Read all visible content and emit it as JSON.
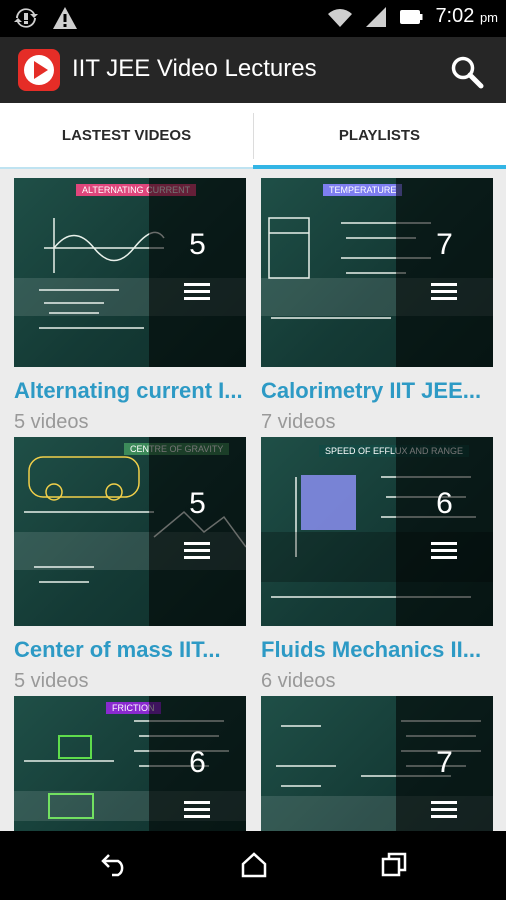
{
  "status_bar": {
    "time": "7:02",
    "ampm": "pm"
  },
  "app_bar": {
    "title": "IIT JEE Video Lectures"
  },
  "tabs": [
    {
      "label": "LASTEST VIDEOS"
    },
    {
      "label": "PLAYLISTS"
    }
  ],
  "playlists": [
    {
      "title": "Alternating current I...",
      "count": "5",
      "subtitle": "5 videos",
      "tag": "ALTERNATING CURRENT",
      "tag_color": "#e0467c"
    },
    {
      "title": "Calorimetry IIT JEE...",
      "count": "7",
      "subtitle": "7 videos",
      "tag": "TEMPERATURE",
      "tag_color": "#7e7ef0"
    },
    {
      "title": "Center of mass IIT...",
      "count": "5",
      "subtitle": "5 videos",
      "tag": "CENTRE OF GRAVITY",
      "tag_color": "#3c8a5a"
    },
    {
      "title": "Fluids Mechanics II...",
      "count": "6",
      "subtitle": "6 videos",
      "tag": "SPEED OF EFFLUX AND RANGE",
      "tag_color": "#134a44"
    },
    {
      "title": "",
      "count": "6",
      "subtitle": "",
      "tag": "FRICTION",
      "tag_color": "#8a2ad0"
    },
    {
      "title": "",
      "count": "7",
      "subtitle": "",
      "tag": "",
      "tag_color": "#134a44"
    }
  ],
  "colors": {
    "accent": "#33b5e5",
    "title_text": "#2d9ac5",
    "app_bar": "#262626",
    "logo": "#e52d27"
  }
}
